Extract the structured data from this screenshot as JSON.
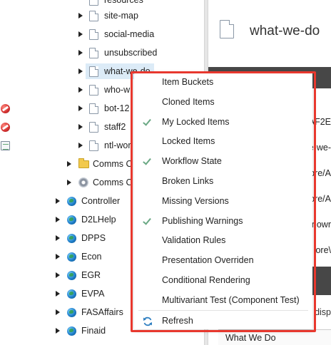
{
  "tree": {
    "top_partial": "resources",
    "children": [
      {
        "label": "site-map"
      },
      {
        "label": "social-media"
      },
      {
        "label": "unsubscribed"
      },
      {
        "label": "what-we-do"
      },
      {
        "label": "who-w"
      },
      {
        "label": "bot-12"
      },
      {
        "label": "staff2"
      },
      {
        "label": "ntl-wor"
      }
    ],
    "comms": [
      {
        "label": "Comms C"
      },
      {
        "label": "Comms C"
      }
    ],
    "sites": [
      {
        "label": "Controller"
      },
      {
        "label": "D2LHelp"
      },
      {
        "label": "DPPS"
      },
      {
        "label": "Econ"
      },
      {
        "label": "EGR"
      },
      {
        "label": "EVPA"
      },
      {
        "label": "FASAffairs"
      },
      {
        "label": "Finaid"
      }
    ]
  },
  "content": {
    "title": "what-we-do",
    "partial_values": [
      "AF2E",
      "e-we-",
      "ore/A",
      "ore/A",
      "nowr",
      "ore\\"
    ],
    "disp_text": "disp",
    "section_label": "What We Do"
  },
  "context_menu": {
    "items": [
      {
        "label": "Item Buckets",
        "checked": false
      },
      {
        "label": "Cloned Items",
        "checked": false
      },
      {
        "label": "My Locked Items",
        "checked": true
      },
      {
        "label": "Locked Items",
        "checked": false
      },
      {
        "label": "Workflow State",
        "checked": true
      },
      {
        "label": "Broken Links",
        "checked": false
      },
      {
        "label": "Missing Versions",
        "checked": false
      },
      {
        "label": "Publishing Warnings",
        "checked": true
      },
      {
        "label": "Validation Rules",
        "checked": false
      },
      {
        "label": "Presentation Overriden",
        "checked": false
      },
      {
        "label": "Conditional Rendering",
        "checked": false
      },
      {
        "label": "Multivariant Test (Component Test)",
        "checked": false
      }
    ],
    "refresh_label": "Refresh",
    "highlight_color": "#e8382e",
    "check_color": "#6aa884"
  }
}
